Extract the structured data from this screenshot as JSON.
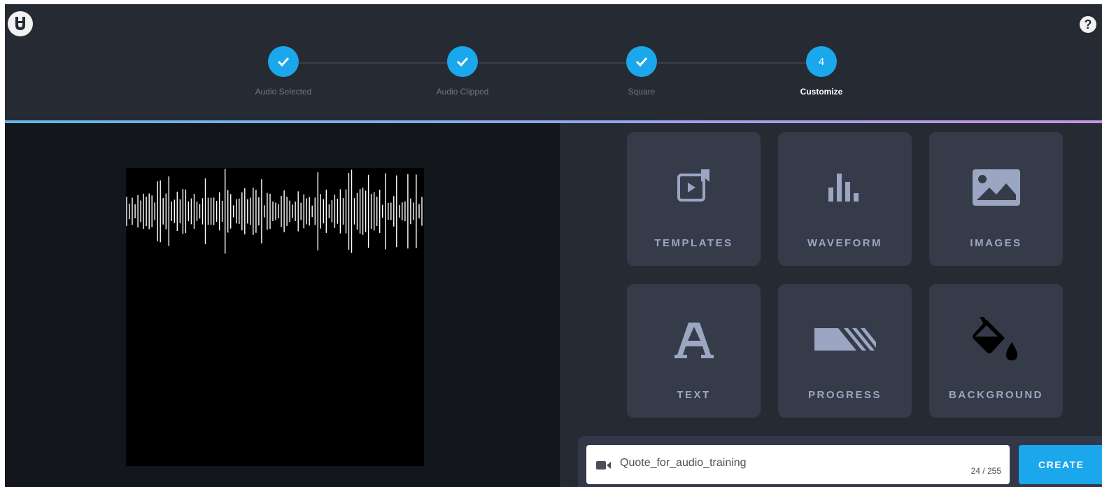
{
  "steps": [
    {
      "label": "Audio Selected",
      "state": "done",
      "icon": "check-icon"
    },
    {
      "label": "Audio Clipped",
      "state": "done",
      "icon": "check-icon"
    },
    {
      "label": "Square",
      "state": "done",
      "icon": "check-icon"
    },
    {
      "label": "Customize",
      "state": "active",
      "number": "4"
    }
  ],
  "header": {
    "help_icon": "?"
  },
  "tiles": [
    {
      "label": "TEMPLATES",
      "icon": "template-icon"
    },
    {
      "label": "WAVEFORM",
      "icon": "waveform-icon"
    },
    {
      "label": "IMAGES",
      "icon": "image-icon"
    },
    {
      "label": "TEXT",
      "icon": "text-icon"
    },
    {
      "label": "PROGRESS",
      "icon": "progress-icon"
    },
    {
      "label": "BACKGROUND",
      "icon": "paint-bucket-icon"
    }
  ],
  "project": {
    "name": "Quote_for_audio_training",
    "counter": "24 / 255",
    "create_label": "CREATE"
  },
  "colors": {
    "accent": "#1aa7ec",
    "panel": "#262a33",
    "tile": "#363b4a",
    "tile_text": "#9ba6c2"
  }
}
